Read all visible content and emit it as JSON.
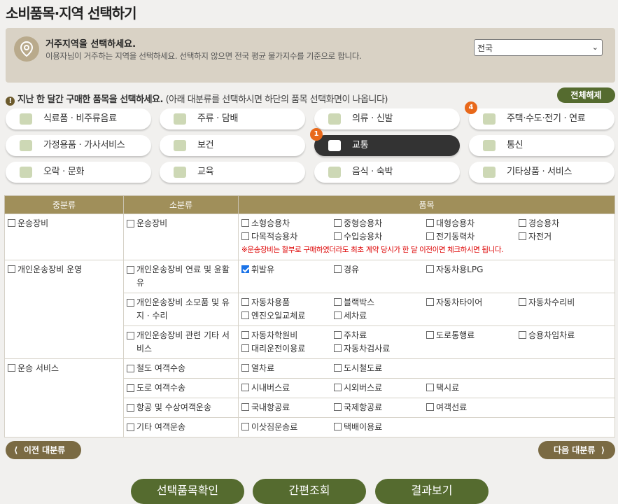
{
  "page_title": "소비품목·지역 선택하기",
  "region": {
    "title": "거주지역을 선택하세요.",
    "description": "이용자님이 거주하는 지역을 선택하세요. 선택하지 않으면 전국 평균 물가지수를 기준으로 합니다.",
    "selected": "전국"
  },
  "notice": {
    "bold": "지난 한 달간 구매한 품목을 선택하세요.",
    "rest": " (아래 대분류를 선택하시면 하단의 품목 선택화면이 나옵니다)"
  },
  "reset_label": "전체해제",
  "categories": [
    {
      "label": "식료품 · 비주류음료",
      "badge": ""
    },
    {
      "label": "주류 · 담배",
      "badge": ""
    },
    {
      "label": "의류 · 신발",
      "badge": ""
    },
    {
      "label": "주택·수도·전기 · 연료",
      "badge": "4"
    },
    {
      "label": "가정용품 · 가사서비스",
      "badge": ""
    },
    {
      "label": "보건",
      "badge": ""
    },
    {
      "label": "교통",
      "badge": "1"
    },
    {
      "label": "통신",
      "badge": ""
    },
    {
      "label": "오락 · 문화",
      "badge": ""
    },
    {
      "label": "교육",
      "badge": ""
    },
    {
      "label": "음식 · 숙박",
      "badge": ""
    },
    {
      "label": "기타상품 · 서비스",
      "badge": ""
    }
  ],
  "table": {
    "headers": [
      "중분류",
      "소분류",
      "품목"
    ],
    "rows": [
      {
        "mid": "운송장비",
        "sub": "운송장비",
        "items": [
          "소형승용차",
          "중형승용차",
          "대형승용차",
          "경승용차",
          "다목적승용차",
          "수입승용차",
          "전기동력차",
          "자전거"
        ],
        "checked": [],
        "note": "※운송장비는 할부로 구매하였더라도 최초 계약 당시가 한 달 이전이면 체크하시면 됩니다."
      },
      {
        "mid": "개인운송장비 운영",
        "sub": "개인운송장비 연료 및 윤활유",
        "items": [
          "휘발유",
          "경유",
          "자동차용LPG"
        ],
        "checked": [
          "휘발유"
        ]
      },
      {
        "mid": "",
        "sub": "개인운송장비 소모품 및 유지 · 수리",
        "items": [
          "자동차용품",
          "블랙박스",
          "자동차타이어",
          "자동차수리비",
          "엔진오일교체료",
          "세차료"
        ],
        "checked": []
      },
      {
        "mid": "",
        "sub": "개인운송장비 관련 기타 서비스",
        "items": [
          "자동차학원비",
          "주차료",
          "도로통행료",
          "승용차임차료",
          "대리운전이용료",
          "자동차검사료"
        ],
        "checked": []
      },
      {
        "mid": "운송 서비스",
        "sub": "철도 여객수송",
        "items": [
          "열차료",
          "도시철도료"
        ],
        "checked": []
      },
      {
        "mid": "",
        "sub": "도로 여객수송",
        "items": [
          "시내버스료",
          "시외버스료",
          "택시료"
        ],
        "checked": []
      },
      {
        "mid": "",
        "sub": "항공 및 수상여객운송",
        "items": [
          "국내항공료",
          "국제항공료",
          "여객선료"
        ],
        "checked": []
      },
      {
        "mid": "",
        "sub": "기타 여객운송",
        "items": [
          "이삿짐운송료",
          "택배이용료"
        ],
        "checked": []
      }
    ]
  },
  "nav": {
    "prev": "이전 대분류",
    "next": "다음 대분류"
  },
  "actions": {
    "confirm": "선택품목확인",
    "quick": "간편조회",
    "result": "결과보기"
  },
  "colors": {
    "accent_green": "#556b2f",
    "header_gold": "#a08f5a",
    "badge_orange": "#e8681a"
  }
}
